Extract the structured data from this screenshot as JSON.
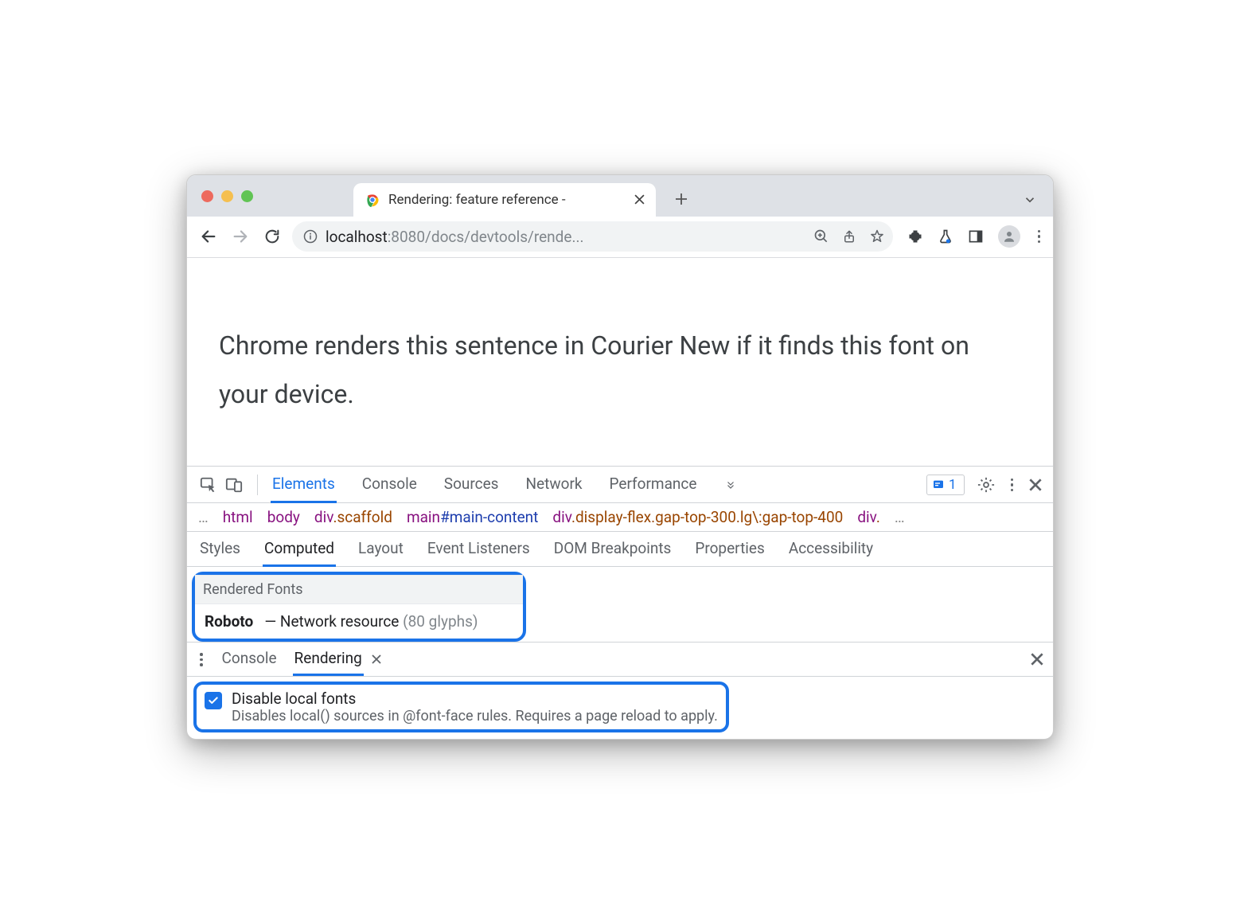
{
  "tab": {
    "title": "Rendering: feature reference -"
  },
  "url": {
    "scheme_info": "",
    "host": "localhost",
    "port": ":8080",
    "path": "/docs/devtools/rende..."
  },
  "page": {
    "text": "Chrome renders this sentence in Courier New if it finds this font on your device."
  },
  "devtools": {
    "tabs": [
      "Elements",
      "Console",
      "Sources",
      "Network",
      "Performance"
    ],
    "active_tab": "Elements",
    "issues_count": "1",
    "breadcrumb": [
      {
        "tag": "html"
      },
      {
        "tag": "body"
      },
      {
        "tag": "div",
        "suffix": ".scaffold"
      },
      {
        "tag": "main",
        "suffix": "#main-content"
      },
      {
        "tag": "div",
        "suffix": ".display-flex.gap-top-300.lg\\:gap-top-400"
      },
      {
        "tag": "div",
        "suffix": "."
      }
    ],
    "sidepanel_tabs": [
      "Styles",
      "Computed",
      "Layout",
      "Event Listeners",
      "DOM Breakpoints",
      "Properties",
      "Accessibility"
    ],
    "sidepanel_active": "Computed",
    "rendered_fonts": {
      "header": "Rendered Fonts",
      "name": "Roboto",
      "source": "—  Network resource",
      "glyphs": "(80 glyphs)"
    },
    "drawer_tabs": [
      "Console",
      "Rendering"
    ],
    "drawer_active": "Rendering",
    "option": {
      "title": "Disable local fonts",
      "desc": "Disables local() sources in @font-face rules. Requires a page reload to apply."
    }
  }
}
